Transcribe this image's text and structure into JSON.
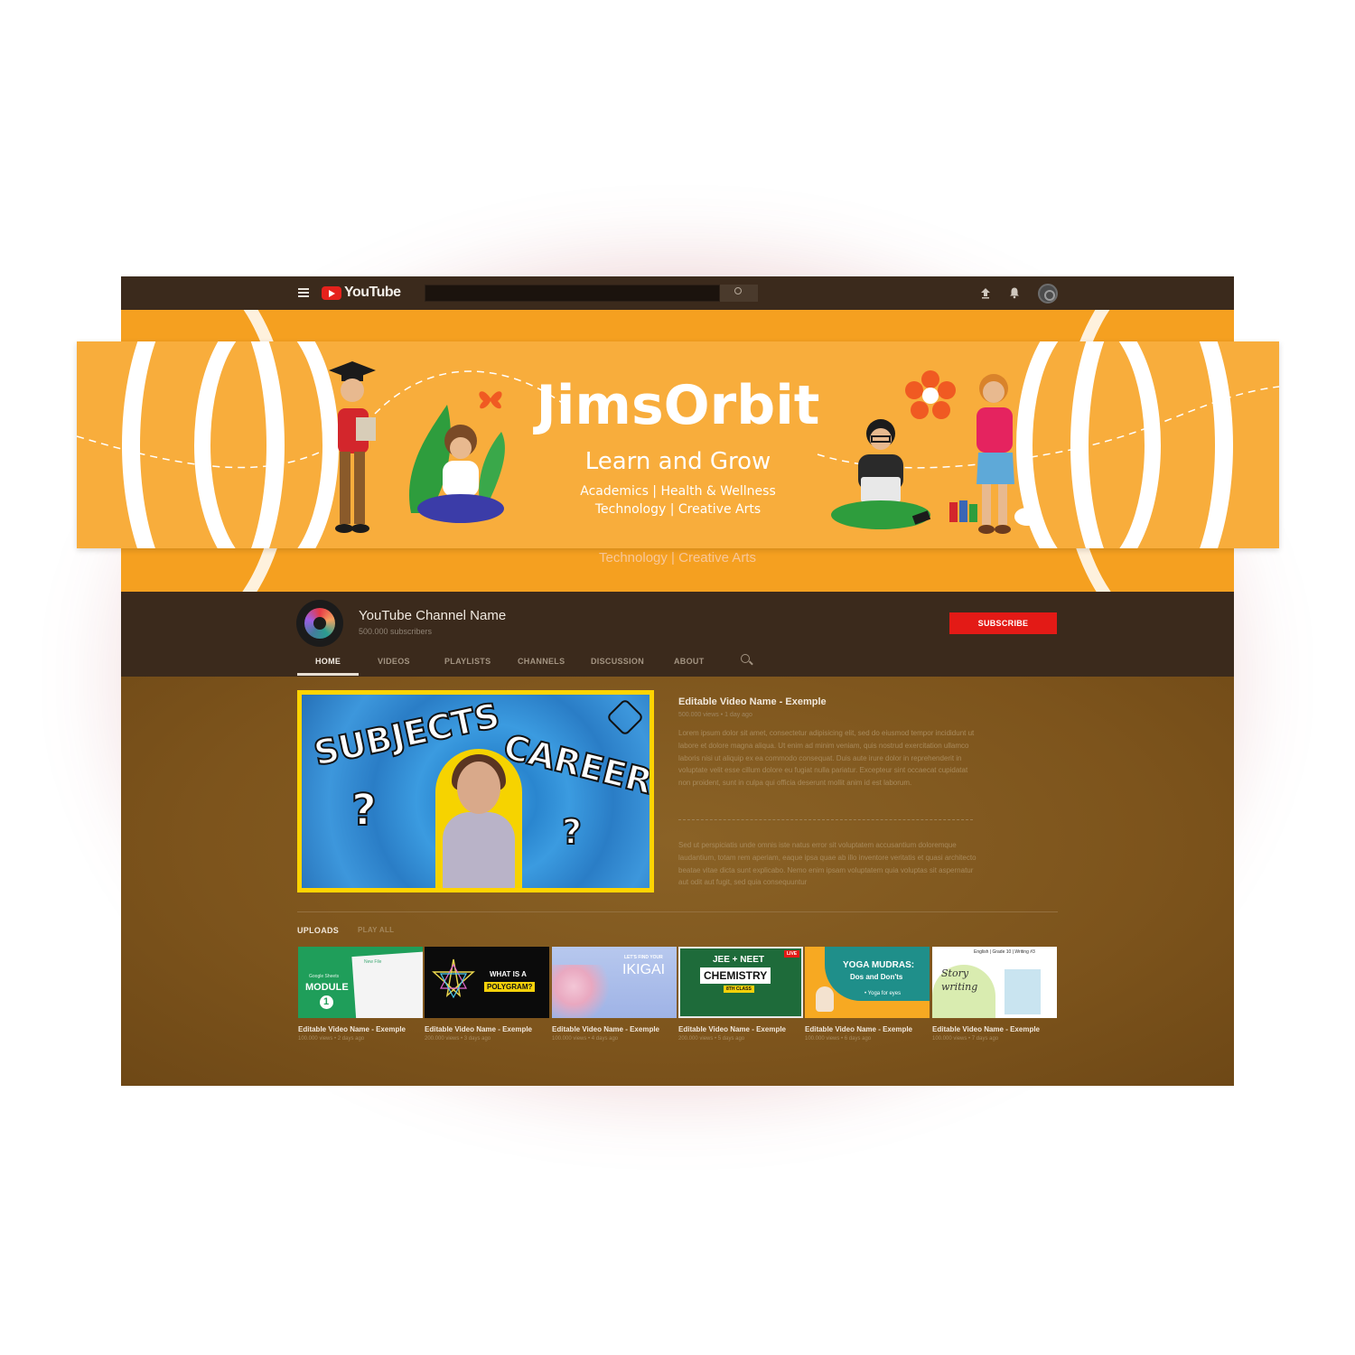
{
  "topbar": {
    "logo_text": "YouTube",
    "icons": [
      "menu-icon",
      "youtube-logo-icon",
      "search-icon",
      "upload-icon",
      "bell-icon",
      "account-avatar"
    ]
  },
  "banner": {
    "title": "JimsOrbit",
    "tagline": "Learn and Grow",
    "subtitle_line1": "Academics | Health & Wellness",
    "subtitle_line2": "Technology | Creative Arts",
    "background_color": "#f8ad3c"
  },
  "channel": {
    "name": "YouTube Channel Name",
    "subscribers": "500.000 subscribers",
    "subscribe_label": "SUBSCRIBE",
    "subscribe_color": "#e31a16"
  },
  "tabs": [
    {
      "label": "HOME",
      "active": true
    },
    {
      "label": "VIDEOS",
      "active": false
    },
    {
      "label": "PLAYLISTS",
      "active": false
    },
    {
      "label": "CHANNELS",
      "active": false
    },
    {
      "label": "DISCUSSION",
      "active": false
    },
    {
      "label": "ABOUT",
      "active": false
    }
  ],
  "featured": {
    "thumb_word1": "SUBJECTS",
    "thumb_word2": "CAREER",
    "thumb_q": "?",
    "title": "Editable Video Name - Exemple",
    "meta": "500.000 views • 1 day ago",
    "desc1": "Lorem ipsum dolor sit amet, consectetur adipisicing elit, sed do eiusmod tempor incididunt ut labore et dolore magna aliqua. Ut enim ad minim veniam, quis nostrud exercitation ullamco laboris nisi ut aliquip ex ea commodo consequat. Duis aute irure dolor in reprehenderit in voluptate velit esse cillum dolore eu fugiat nulla pariatur. Excepteur sint occaecat cupidatat non proident, sunt in culpa qui officia deserunt mollit anim id est laborum.",
    "desc2": "Sed ut perspiciatis unde omnis iste natus error sit voluptatem accusantium doloremque laudantium, totam rem aperiam, eaque ipsa quae ab illo inventore veritatis et quasi architecto beatae vitae dicta sunt explicabo. Nemo enim ipsam voluptatem quia voluptas sit aspernatur aut odit aut fugit, sed quia consequuntur"
  },
  "uploads": {
    "label": "UPLOADS",
    "play_all": "PLAY ALL",
    "videos": [
      {
        "title": "Editable Video Name - Exemple",
        "meta": "100.000 views • 2 days ago",
        "thumb_text": [
          "Google Sheets",
          "MODULE",
          "1",
          "New File"
        ]
      },
      {
        "title": "Editable Video Name - Exemple",
        "meta": "200.000 views • 3 days ago",
        "thumb_text": [
          "WHAT IS A",
          "POLYGRAM?"
        ]
      },
      {
        "title": "Editable Video Name - Exemple",
        "meta": "100.000 views • 4 days ago",
        "thumb_text": [
          "LET'S FIND YOUR",
          "IKIGAI"
        ]
      },
      {
        "title": "Editable Video Name - Exemple",
        "meta": "200.000 views • 5 days ago",
        "thumb_text": [
          "JEE + NEET",
          "CHEMISTRY",
          "8TH CLASS",
          "LIVE"
        ]
      },
      {
        "title": "Editable Video Name - Exemple",
        "meta": "100.000 views • 6 days ago",
        "thumb_text": [
          "YOGA MUDRAS:",
          "Dos and Don'ts",
          "• Yoga for eyes"
        ]
      },
      {
        "title": "Editable Video Name - Exemple",
        "meta": "100.000 views • 7 days ago",
        "thumb_text": [
          "English | Grade 10 | Writing #3",
          "Story",
          "writing"
        ]
      }
    ]
  }
}
